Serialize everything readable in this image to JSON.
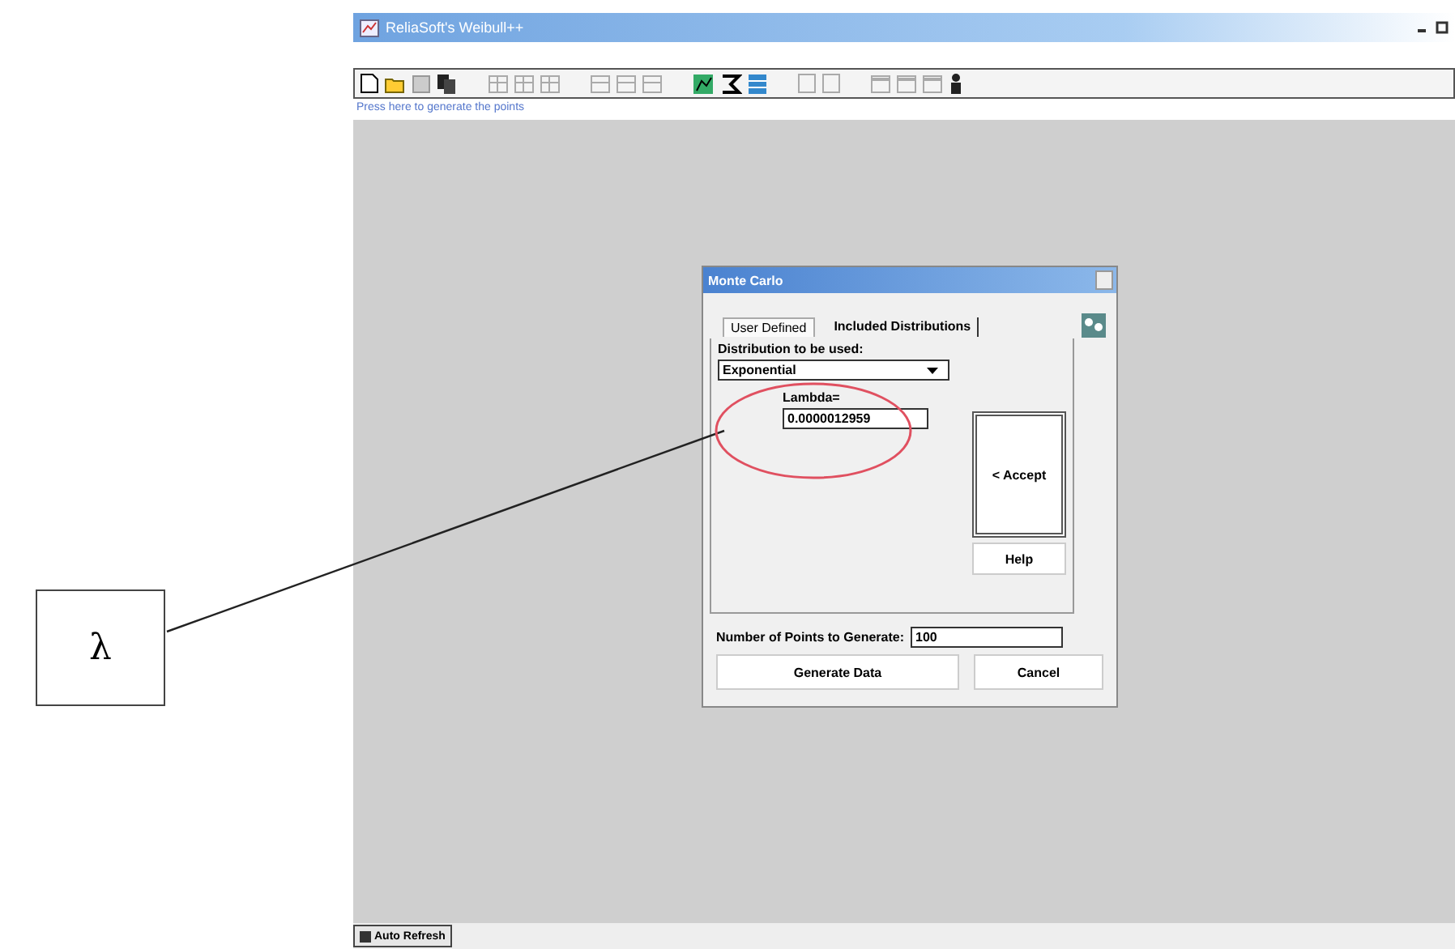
{
  "window": {
    "title": "ReliaSoft's Weibull++"
  },
  "hint": "Press here to generate the points",
  "dialog": {
    "title": "Monte Carlo",
    "tabs": [
      {
        "label": "User Defined",
        "selected": true
      },
      {
        "label": "Included Distributions",
        "selected": false
      }
    ],
    "distribution_label": "Distribution to be used:",
    "distribution": "Exponential",
    "parameter_label": "Lambda=",
    "parameter_value": "0.0000012959",
    "accept": "< Accept",
    "help": "Help",
    "points_label": "Number of Points to Generate:",
    "points_value": "100",
    "buttons": [
      "Generate Data",
      "Cancel"
    ]
  },
  "status_bar": {
    "auto_refresh": {
      "label": "Auto Refresh",
      "checked": true
    }
  },
  "annotation": {
    "label": "λ"
  }
}
